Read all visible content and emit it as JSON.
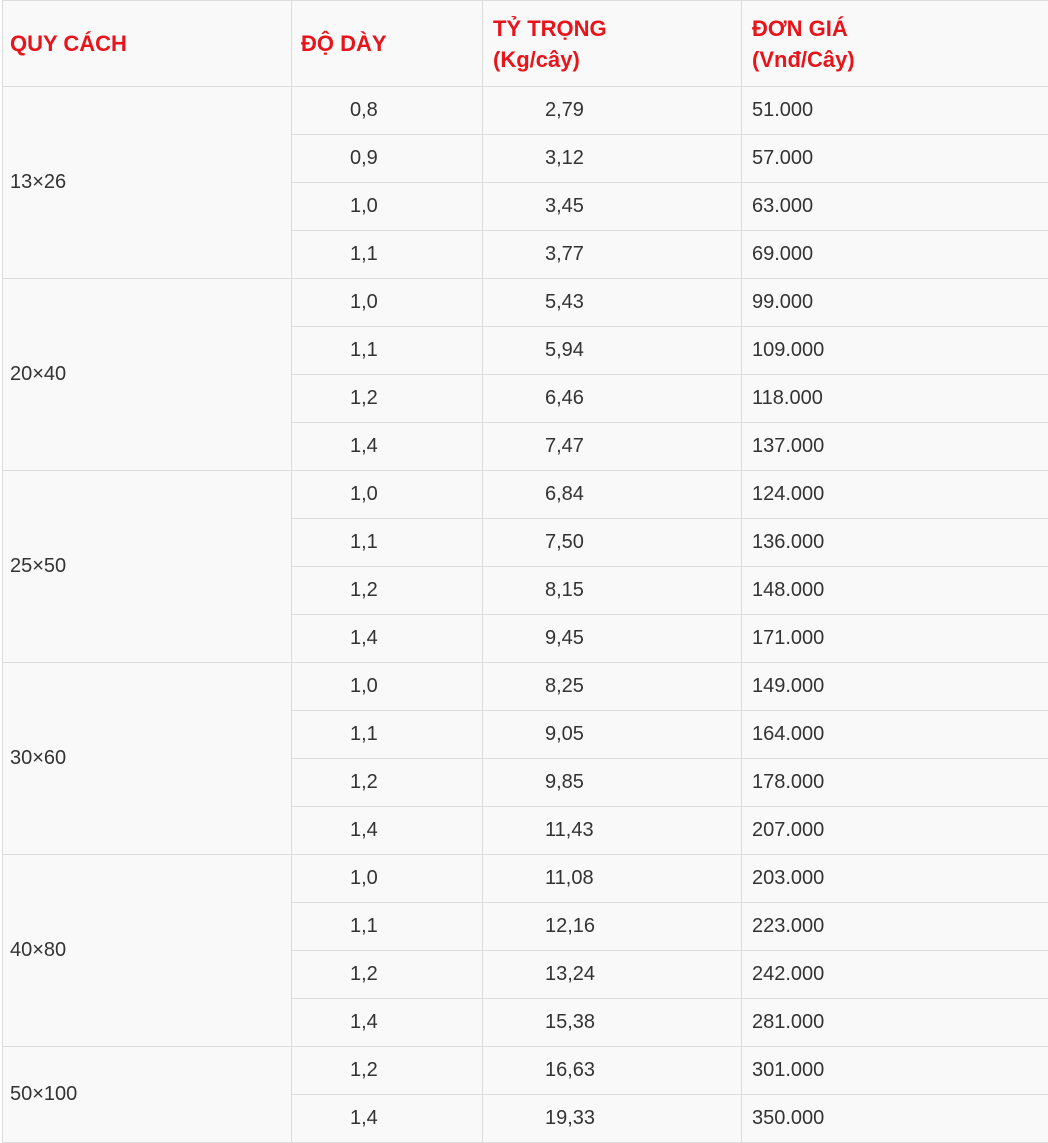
{
  "headers": {
    "spec": "QUY CÁCH",
    "thickness": "ĐỘ DÀY",
    "weight_line1": "TỶ TRỌNG",
    "weight_line2": "(Kg/cây)",
    "price_line1": "ĐƠN GIÁ",
    "price_line2": "(Vnđ/Cây)"
  },
  "accent_color": "#e8141b",
  "groups": [
    {
      "spec": "13×26",
      "rows": [
        {
          "thickness": "0,8",
          "weight": "2,79",
          "price": "51.000"
        },
        {
          "thickness": "0,9",
          "weight": "3,12",
          "price": "57.000"
        },
        {
          "thickness": "1,0",
          "weight": "3,45",
          "price": "63.000"
        },
        {
          "thickness": "1,1",
          "weight": "3,77",
          "price": "69.000"
        }
      ]
    },
    {
      "spec": "20×40",
      "rows": [
        {
          "thickness": "1,0",
          "weight": "5,43",
          "price": "99.000"
        },
        {
          "thickness": "1,1",
          "weight": "5,94",
          "price": "109.000"
        },
        {
          "thickness": "1,2",
          "weight": "6,46",
          "price": "118.000"
        },
        {
          "thickness": "1,4",
          "weight": "7,47",
          "price": "137.000"
        }
      ]
    },
    {
      "spec": "25×50",
      "rows": [
        {
          "thickness": "1,0",
          "weight": "6,84",
          "price": "124.000"
        },
        {
          "thickness": "1,1",
          "weight": "7,50",
          "price": "136.000"
        },
        {
          "thickness": "1,2",
          "weight": "8,15",
          "price": "148.000"
        },
        {
          "thickness": "1,4",
          "weight": "9,45",
          "price": "171.000"
        }
      ]
    },
    {
      "spec": "30×60",
      "rows": [
        {
          "thickness": "1,0",
          "weight": "8,25",
          "price": "149.000"
        },
        {
          "thickness": "1,1",
          "weight": "9,05",
          "price": "164.000"
        },
        {
          "thickness": "1,2",
          "weight": "9,85",
          "price": "178.000"
        },
        {
          "thickness": "1,4",
          "weight": "11,43",
          "price": "207.000"
        }
      ]
    },
    {
      "spec": "40×80",
      "rows": [
        {
          "thickness": "1,0",
          "weight": "11,08",
          "price": "203.000"
        },
        {
          "thickness": "1,1",
          "weight": "12,16",
          "price": "223.000"
        },
        {
          "thickness": "1,2",
          "weight": "13,24",
          "price": "242.000"
        },
        {
          "thickness": "1,4",
          "weight": "15,38",
          "price": "281.000"
        }
      ]
    },
    {
      "spec": "50×100",
      "rows": [
        {
          "thickness": "1,2",
          "weight": "16,63",
          "price": "301.000"
        },
        {
          "thickness": "1,4",
          "weight": "19,33",
          "price": "350.000"
        }
      ]
    }
  ]
}
